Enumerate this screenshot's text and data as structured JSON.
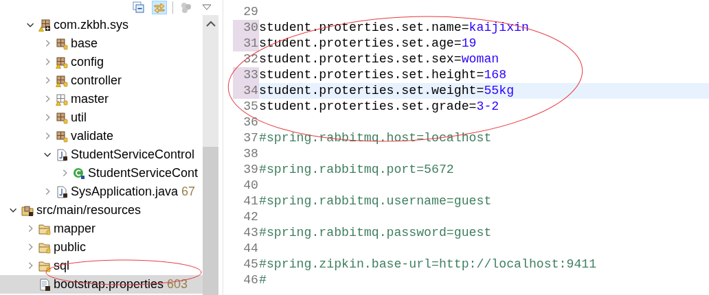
{
  "explorer": {
    "tree": [
      {
        "label": "com.zkbh.sys",
        "kind": "package-root",
        "warning": true,
        "expandable": true,
        "expanded": true,
        "selected": false,
        "children": [
          {
            "label": "base",
            "kind": "package",
            "warning": false,
            "expandable": true,
            "expanded": false,
            "selected": false
          },
          {
            "label": "config",
            "kind": "package",
            "warning": true,
            "expandable": true,
            "expanded": false,
            "selected": false
          },
          {
            "label": "controller",
            "kind": "package",
            "warning": true,
            "expandable": true,
            "expanded": false,
            "selected": false
          },
          {
            "label": "master",
            "kind": "package-empty",
            "warning": true,
            "expandable": true,
            "expanded": false,
            "selected": false
          },
          {
            "label": "util",
            "kind": "package",
            "warning": false,
            "expandable": true,
            "expanded": false,
            "selected": false
          },
          {
            "label": "validate",
            "kind": "package",
            "warning": false,
            "expandable": true,
            "expanded": false,
            "selected": false
          },
          {
            "label": "StudentServiceControl",
            "kind": "java-file",
            "warning": false,
            "expandable": true,
            "expanded": true,
            "selected": false,
            "children": [
              {
                "label": "StudentServiceCont",
                "kind": "class",
                "warning": false,
                "expandable": true,
                "expanded": false,
                "selected": false
              }
            ]
          },
          {
            "label": "SysApplication.java",
            "decoration": "67",
            "kind": "java-file",
            "warning": false,
            "expandable": true,
            "expanded": false,
            "selected": false
          }
        ]
      },
      {
        "label": "src/main/resources",
        "kind": "source-folder",
        "warning": false,
        "expandable": true,
        "expanded": true,
        "selected": false,
        "children": [
          {
            "label": "mapper",
            "kind": "folder",
            "warning": false,
            "expandable": true,
            "expanded": false,
            "selected": false
          },
          {
            "label": "public",
            "kind": "folder",
            "warning": false,
            "expandable": true,
            "expanded": false,
            "selected": false
          },
          {
            "label": "sql",
            "kind": "folder",
            "warning": false,
            "expandable": true,
            "expanded": false,
            "selected": false
          },
          {
            "label": "bootstrap.properties",
            "decoration": "603",
            "kind": "properties-file",
            "warning": false,
            "expandable": false,
            "expanded": false,
            "selected": true
          }
        ]
      }
    ]
  },
  "editor": {
    "lines": [
      {
        "number": "29",
        "kind": "blank",
        "changed": false,
        "current": false
      },
      {
        "number": "30",
        "kind": "property",
        "key": "student.proterties.set.name=",
        "value": "kaijixin",
        "changed": true,
        "current": false
      },
      {
        "number": "31",
        "kind": "property",
        "key": "student.proterties.set.age=",
        "value": "19",
        "changed": true,
        "current": false
      },
      {
        "number": "32",
        "kind": "property",
        "key": "student.proterties.set.sex=",
        "value": "woman",
        "changed": false,
        "current": false
      },
      {
        "number": "33",
        "kind": "property",
        "key": "student.proterties.set.height=",
        "value": "168",
        "changed": true,
        "current": false
      },
      {
        "number": "34",
        "kind": "property",
        "key": "student.proterties.set.weight=",
        "value": "55kg",
        "changed": true,
        "current": true
      },
      {
        "number": "35",
        "kind": "property",
        "key": "student.proterties.set.grade=",
        "value": "3-2",
        "changed": false,
        "current": false
      },
      {
        "number": "36",
        "kind": "blank",
        "changed": false,
        "current": false
      },
      {
        "number": "37",
        "kind": "comment",
        "text": "#spring.rabbitmq.host=localhost",
        "changed": false,
        "current": false
      },
      {
        "number": "38",
        "kind": "blank",
        "changed": false,
        "current": false
      },
      {
        "number": "39",
        "kind": "comment",
        "text": "#spring.rabbitmq.port=5672",
        "changed": false,
        "current": false
      },
      {
        "number": "40",
        "kind": "blank",
        "changed": false,
        "current": false
      },
      {
        "number": "41",
        "kind": "comment",
        "text": "#spring.rabbitmq.username=guest",
        "changed": false,
        "current": false
      },
      {
        "number": "42",
        "kind": "blank",
        "changed": false,
        "current": false
      },
      {
        "number": "43",
        "kind": "comment",
        "text": "#spring.rabbitmq.password=guest",
        "changed": false,
        "current": false
      },
      {
        "number": "44",
        "kind": "blank",
        "changed": false,
        "current": false
      },
      {
        "number": "45",
        "kind": "comment",
        "text": "#spring.zipkin.base-url=http://localhost:9411",
        "changed": false,
        "current": false
      },
      {
        "number": "46",
        "kind": "comment",
        "text": "#",
        "changed": false,
        "current": false
      }
    ]
  }
}
